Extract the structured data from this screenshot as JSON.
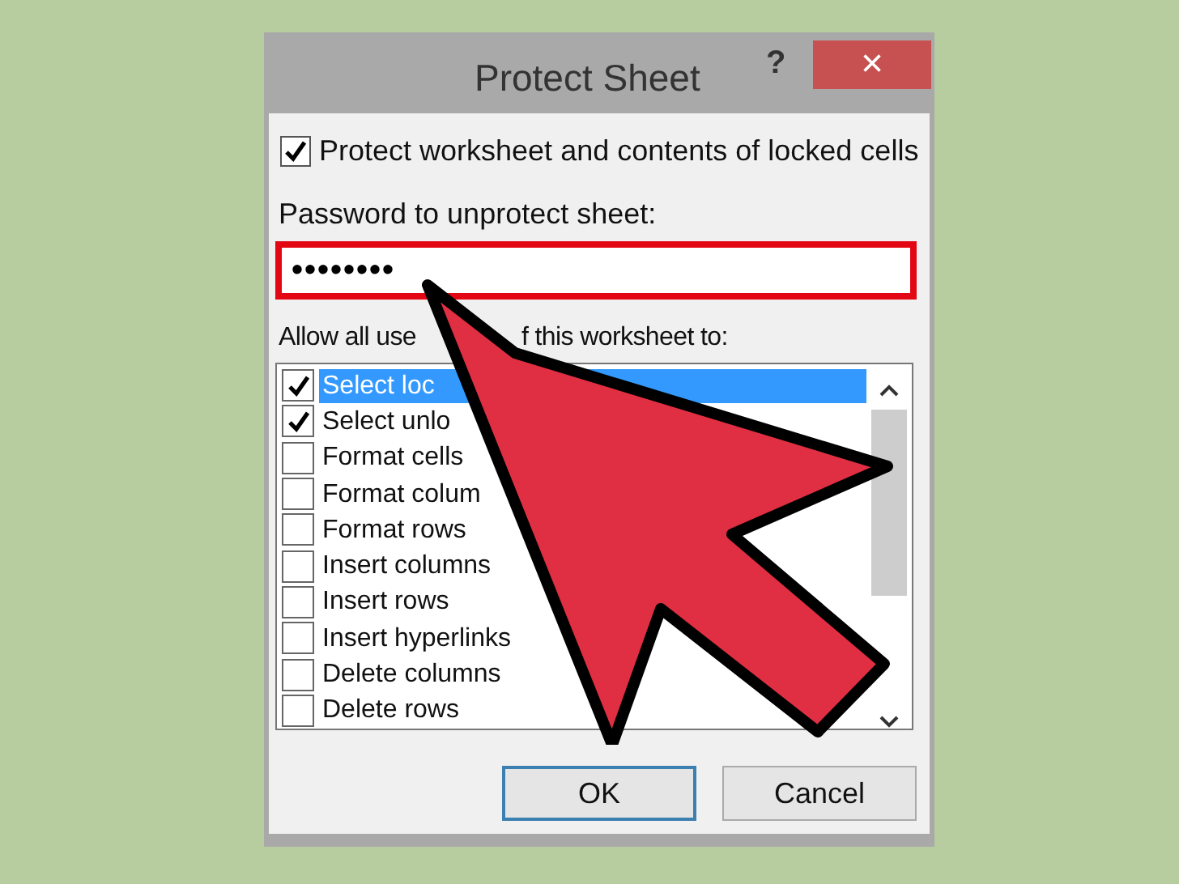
{
  "window": {
    "title": "Protect Sheet",
    "help": "?",
    "close": "×"
  },
  "protect_checkbox": {
    "label": "Protect worksheet and contents of locked cells",
    "checked": true
  },
  "password": {
    "label": "Password to unprotect sheet:",
    "value": "••••••••"
  },
  "allow_label": {
    "parts": [
      "Allow all use",
      "f this worksheet to:"
    ]
  },
  "permissions": [
    {
      "label": "Select loc",
      "checked": true,
      "selected": true
    },
    {
      "label": "Select unlo",
      "checked": true,
      "selected": false
    },
    {
      "label": "Format cells",
      "checked": false,
      "selected": false
    },
    {
      "label": "Format colum",
      "checked": false,
      "selected": false
    },
    {
      "label": "Format rows",
      "checked": false,
      "selected": false
    },
    {
      "label": "Insert columns",
      "checked": false,
      "selected": false
    },
    {
      "label": "Insert rows",
      "checked": false,
      "selected": false
    },
    {
      "label": "Insert hyperlinks",
      "checked": false,
      "selected": false
    },
    {
      "label": "Delete columns",
      "checked": false,
      "selected": false
    },
    {
      "label": "Delete rows",
      "checked": false,
      "selected": false
    }
  ],
  "buttons": [
    {
      "label": "OK",
      "default": true
    },
    {
      "label": "Cancel",
      "default": false
    }
  ]
}
